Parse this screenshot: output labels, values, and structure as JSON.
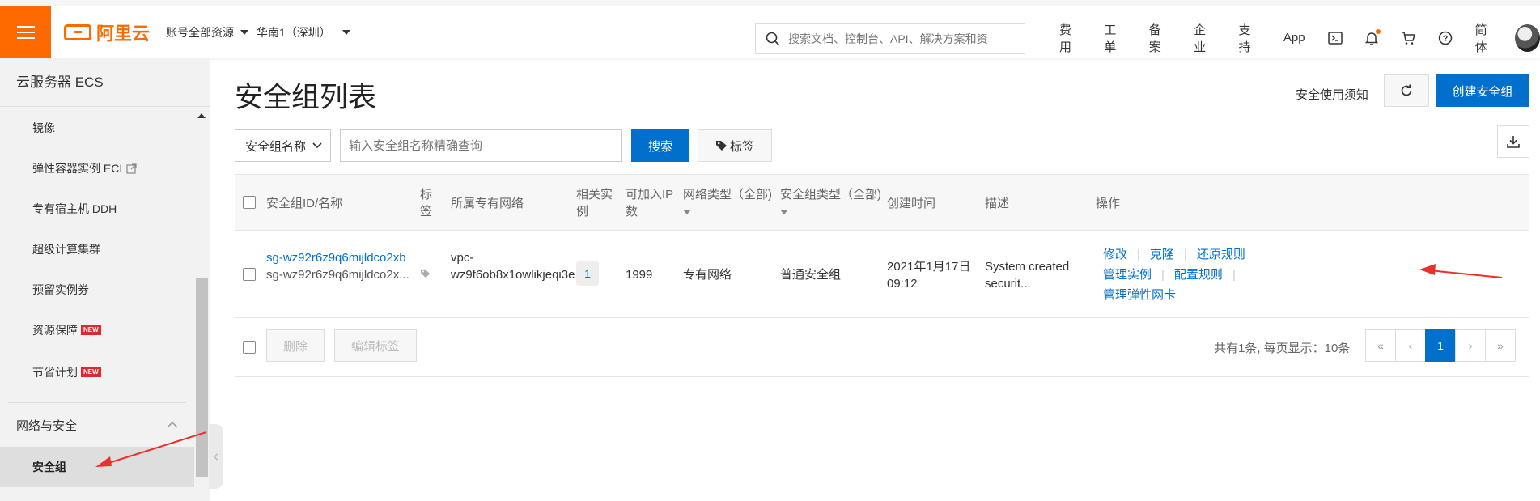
{
  "topbar": {
    "logo_text": "阿里云",
    "account_scope": "账号全部资源",
    "region": "华南1（深圳）",
    "search_placeholder": "搜索文档、控制台、API、解决方案和资",
    "nav": [
      "费用",
      "工单",
      "备案",
      "企业",
      "支持",
      "App"
    ],
    "language": "简体",
    "accent_color": "#ff6a00"
  },
  "sidebar": {
    "title": "云服务器 ECS",
    "items": [
      {
        "label": "镜像"
      },
      {
        "label": "弹性容器实例 ECI"
      },
      {
        "label": "专有宿主机 DDH"
      },
      {
        "label": "超级计算集群"
      },
      {
        "label": "预留实例券"
      },
      {
        "label": "资源保障",
        "badge": "NEW"
      },
      {
        "label": "节省计划",
        "badge": "NEW"
      }
    ],
    "group": "网络与安全",
    "active_item": "安全组"
  },
  "main": {
    "title": "安全组列表",
    "notice_link": "安全使用须知",
    "create_button": "创建安全组",
    "filter_select": "安全组名称",
    "filter_placeholder": "输入安全组名称精确查询",
    "search_button": "搜索",
    "tag_button": "标签"
  },
  "table": {
    "headers": {
      "id_name": "安全组ID/名称",
      "tag_1": "标",
      "tag_2": "签",
      "vpc": "所属专有网络",
      "related_1": "相关实",
      "related_2": "例",
      "ip_1": "可加入IP",
      "ip_2": "数",
      "net_type": "网络类型（全部)",
      "sg_type": "安全组类型（全部)",
      "created": "创建时间",
      "desc": "描述",
      "ops": "操作"
    },
    "rows": [
      {
        "id": "sg-wz92r6z9q6mijldco2xb",
        "name": "sg-wz92r6z9q6mijldco2x...",
        "vpc_1": "vpc-",
        "vpc_2": "wz9f6ob8x1owlikjeqi3e",
        "related": "1",
        "ip_count": "1999",
        "net_type": "专有网络",
        "sg_type": "普通安全组",
        "created_1": "2021年1月17日",
        "created_2": "09:12",
        "desc_1": "System created",
        "desc_2": "securit...",
        "actions": {
          "modify": "修改",
          "clone": "克隆",
          "restore": "还原规则",
          "manage_instances": "管理实例",
          "configure_rules": "配置规则",
          "manage_eni": "管理弹性网卡"
        }
      }
    ],
    "footer": {
      "delete": "删除",
      "edit_tags": "编辑标签",
      "summary": "共有1条, 每页显示：10条",
      "pages": [
        "«",
        "‹",
        "1",
        "›",
        "»"
      ],
      "current_page": "1"
    }
  },
  "colors": {
    "primary": "#0070cc",
    "annotation": "#e8312a"
  }
}
